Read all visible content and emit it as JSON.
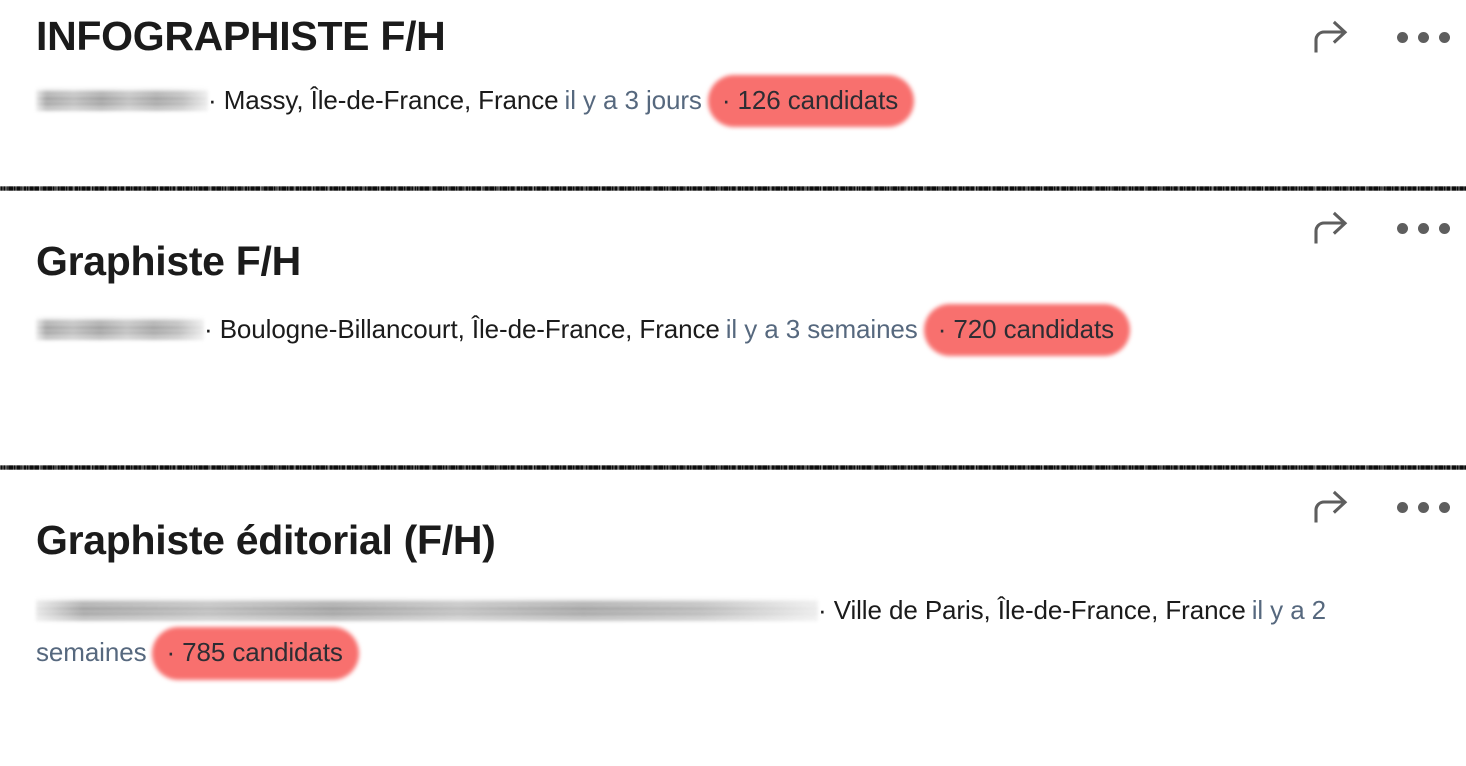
{
  "theme": {
    "background": "#ffffff",
    "title_color": "#1b1b1b",
    "meta_color": "#1b1b1b",
    "posted_ago_color": "#56687e",
    "highlight_color": "#f8706e",
    "icon_color": "#5e5e5e",
    "divider_color": "#0b0b0b"
  },
  "actions": {
    "share_label": "share-icon",
    "more_label": "more-options-icon"
  },
  "jobs": [
    {
      "title": "INFOGRAPHISTE F/H",
      "company_redacted": true,
      "company_redaction_width": 172,
      "separator": "·",
      "location": "Massy, Île-de-France, France",
      "posted_ago": "il y a 3 jours",
      "candidates": "· 126 candidats",
      "candidates_count": 126,
      "highlighted": true
    },
    {
      "title": "Graphiste F/H",
      "company_redacted": true,
      "company_redaction_width": 168,
      "separator": "·",
      "location": "Boulogne-Billancourt, Île-de-France, France",
      "posted_ago": "il y a 3 semaines",
      "candidates": "· 720 candidats",
      "candidates_count": 720,
      "highlighted": true
    },
    {
      "title": "Graphiste éditorial (F/H)",
      "company_redacted": true,
      "company_redaction_width": 782,
      "separator": "·",
      "location": "Ville de Paris, Île-de-France, France",
      "posted_ago": "il y a 2 semaines",
      "candidates": "· 785 candidats",
      "candidates_count": 785,
      "highlighted": true
    }
  ]
}
